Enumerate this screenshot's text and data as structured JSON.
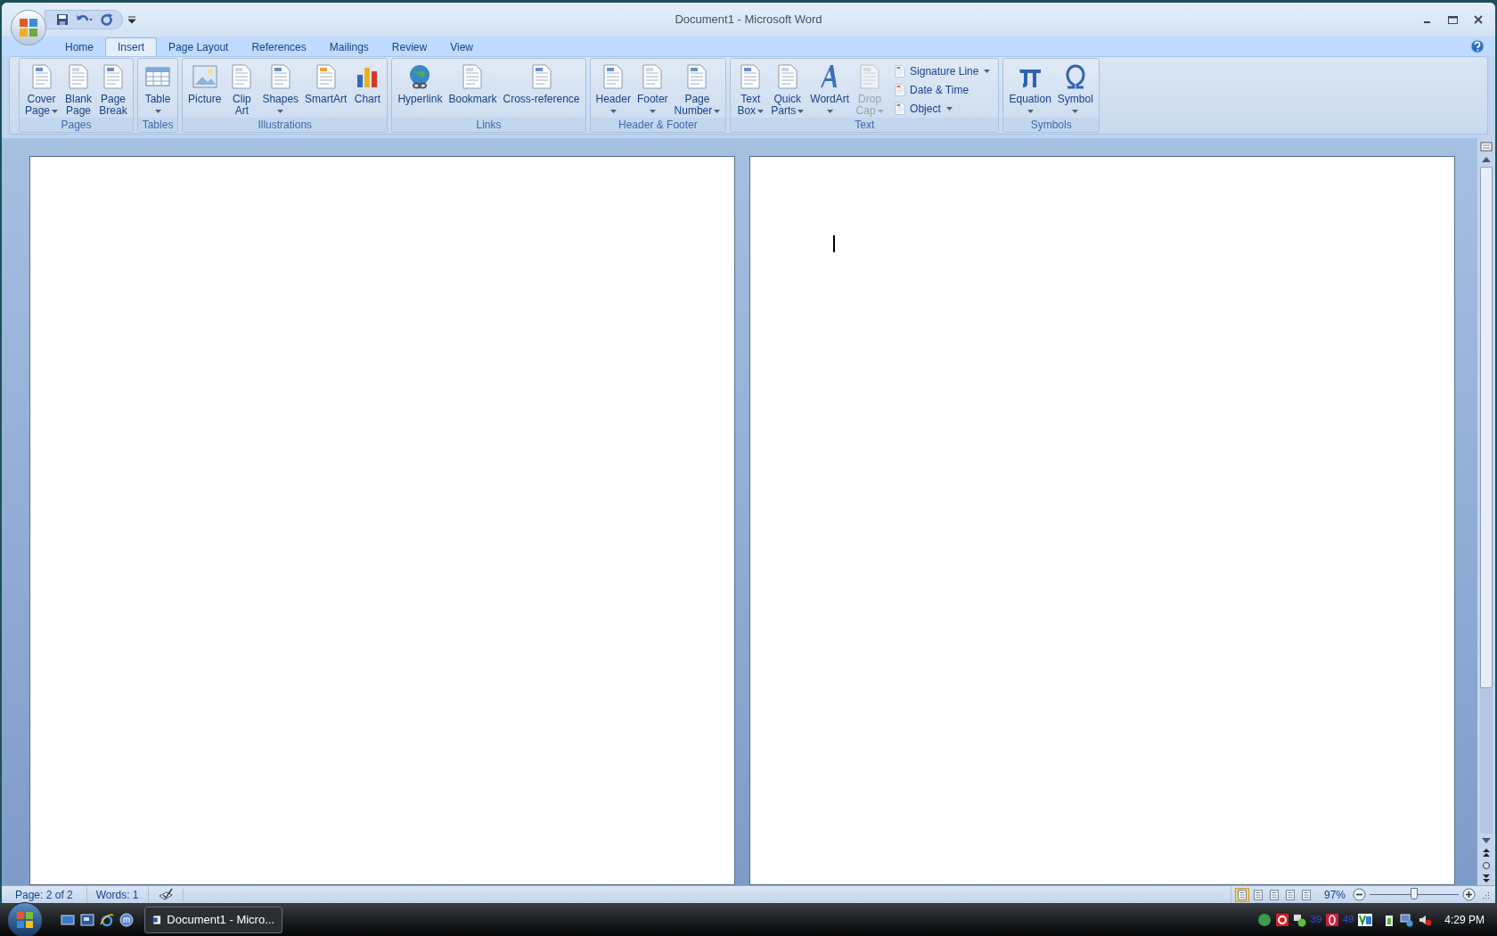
{
  "window": {
    "title": "Document1 - Microsoft Word"
  },
  "tabs": [
    {
      "label": "Home",
      "selected": false
    },
    {
      "label": "Insert",
      "selected": true
    },
    {
      "label": "Page Layout",
      "selected": false
    },
    {
      "label": "References",
      "selected": false
    },
    {
      "label": "Mailings",
      "selected": false
    },
    {
      "label": "Review",
      "selected": false
    },
    {
      "label": "View",
      "selected": false
    }
  ],
  "ribbon": {
    "groups": [
      {
        "label": "Pages",
        "items": [
          {
            "kind": "large",
            "lines": [
              "Cover",
              "Page"
            ],
            "dropdown": true,
            "disabled": false
          },
          {
            "kind": "large",
            "lines": [
              "Blank",
              "Page"
            ],
            "dropdown": false,
            "disabled": false
          },
          {
            "kind": "large",
            "lines": [
              "Page",
              "Break"
            ],
            "dropdown": false,
            "disabled": false
          }
        ]
      },
      {
        "label": "Tables",
        "items": [
          {
            "kind": "large",
            "lines": [
              "Table"
            ],
            "dropdown": true,
            "disabled": false
          }
        ]
      },
      {
        "label": "Illustrations",
        "items": [
          {
            "kind": "large",
            "lines": [
              "Picture"
            ],
            "dropdown": false,
            "disabled": false
          },
          {
            "kind": "large",
            "lines": [
              "Clip",
              "Art"
            ],
            "dropdown": false,
            "disabled": false
          },
          {
            "kind": "large",
            "lines": [
              "Shapes"
            ],
            "dropdown": true,
            "disabled": false
          },
          {
            "kind": "large",
            "lines": [
              "SmartArt"
            ],
            "dropdown": false,
            "disabled": false
          },
          {
            "kind": "large",
            "lines": [
              "Chart"
            ],
            "dropdown": false,
            "disabled": false
          }
        ]
      },
      {
        "label": "Links",
        "items": [
          {
            "kind": "large",
            "lines": [
              "Hyperlink"
            ],
            "dropdown": false,
            "disabled": false
          },
          {
            "kind": "large",
            "lines": [
              "Bookmark"
            ],
            "dropdown": false,
            "disabled": false
          },
          {
            "kind": "large",
            "lines": [
              "Cross-reference"
            ],
            "dropdown": false,
            "disabled": false
          }
        ]
      },
      {
        "label": "Header & Footer",
        "items": [
          {
            "kind": "large",
            "lines": [
              "Header"
            ],
            "dropdown": true,
            "disabled": false
          },
          {
            "kind": "large",
            "lines": [
              "Footer"
            ],
            "dropdown": true,
            "disabled": false
          },
          {
            "kind": "large",
            "lines": [
              "Page",
              "Number"
            ],
            "dropdown": true,
            "disabled": false
          }
        ]
      },
      {
        "label": "Text",
        "items": [
          {
            "kind": "large",
            "lines": [
              "Text",
              "Box"
            ],
            "dropdown": true,
            "disabled": false
          },
          {
            "kind": "large",
            "lines": [
              "Quick",
              "Parts"
            ],
            "dropdown": true,
            "disabled": false
          },
          {
            "kind": "large",
            "lines": [
              "WordArt"
            ],
            "dropdown": true,
            "disabled": false
          },
          {
            "kind": "large",
            "lines": [
              "Drop",
              "Cap"
            ],
            "dropdown": true,
            "disabled": true
          },
          {
            "kind": "small",
            "lines": [
              "Signature Line"
            ],
            "dropdown": true,
            "disabled": false
          },
          {
            "kind": "small",
            "lines": [
              "Date & Time"
            ],
            "dropdown": false,
            "disabled": false
          },
          {
            "kind": "small",
            "lines": [
              "Object"
            ],
            "dropdown": true,
            "disabled": false
          }
        ]
      },
      {
        "label": "Symbols",
        "items": [
          {
            "kind": "large",
            "lines": [
              "Equation"
            ],
            "dropdown": true,
            "disabled": false
          },
          {
            "kind": "large",
            "lines": [
              "Symbol"
            ],
            "dropdown": true,
            "disabled": false
          }
        ]
      }
    ]
  },
  "status_bar": {
    "page": "Page: 2 of 2",
    "words": "Words: 1",
    "views": [
      {
        "selected": true
      },
      {
        "selected": false
      },
      {
        "selected": false
      },
      {
        "selected": false
      },
      {
        "selected": false
      }
    ],
    "zoom": "97%",
    "zoom_slider": {
      "level": 0.5
    }
  },
  "taskbar": {
    "task": "Document1 - Micro...",
    "tray_counts": [
      "39",
      "49"
    ],
    "clock": "4:29 PM"
  }
}
